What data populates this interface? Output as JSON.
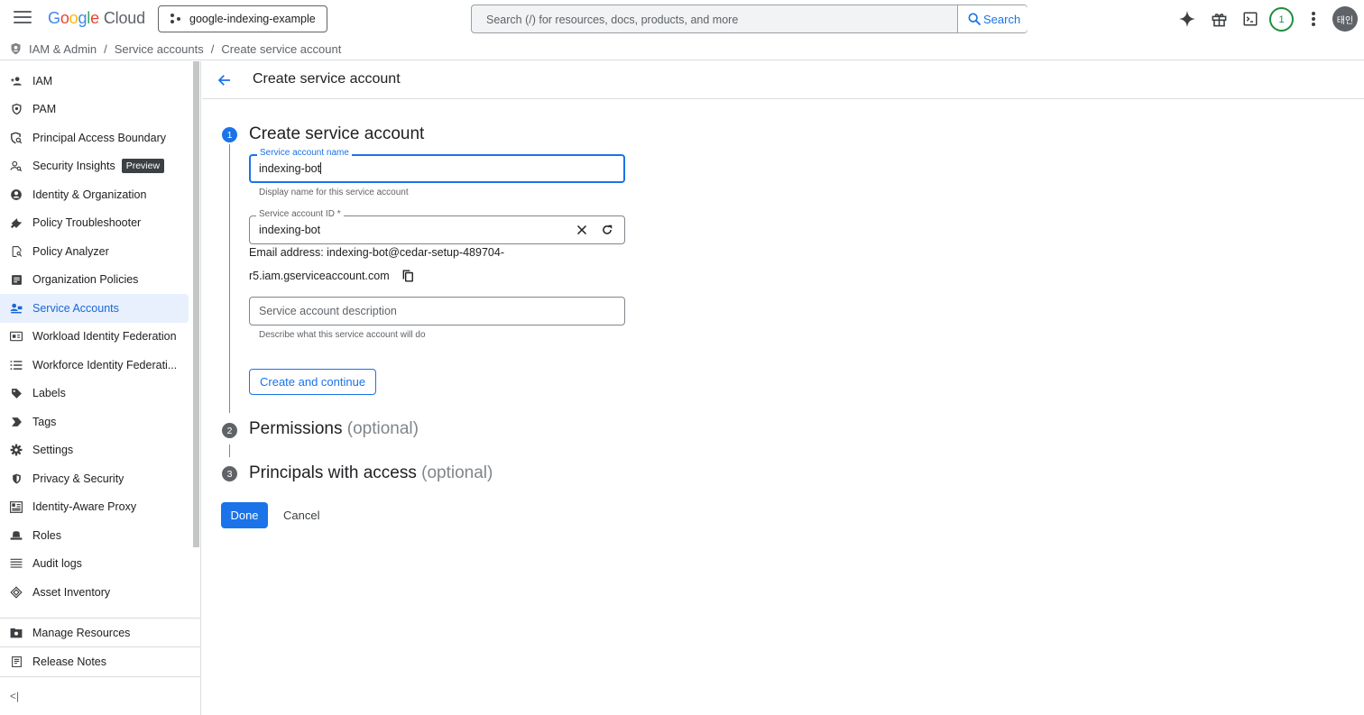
{
  "topbar": {
    "logo_letters": [
      "G",
      "o",
      "o",
      "g",
      "l",
      "e"
    ],
    "logo_product": "Cloud",
    "project_name": "google-indexing-example",
    "search_placeholder": "Search (/) for resources, docs, products, and more",
    "search_button": "Search",
    "notification_count": "1",
    "avatar_text": "태인",
    "icons": [
      "menu-icon",
      "gemini-sparkle-icon",
      "gift-icon",
      "cloud-shell-icon",
      "more-vert-icon"
    ]
  },
  "breadcrumb": {
    "items": [
      "IAM & Admin",
      "Service accounts",
      "Create service account"
    ],
    "separator": "/"
  },
  "sidebar": {
    "items": [
      {
        "label": "IAM",
        "icon": "person-add-icon"
      },
      {
        "label": "PAM",
        "icon": "shield-lock-icon"
      },
      {
        "label": "Principal Access Boundary",
        "icon": "shield-search-icon"
      },
      {
        "label": "Security Insights",
        "icon": "person-search-icon",
        "tag": "Preview"
      },
      {
        "label": "Identity & Organization",
        "icon": "account-circle-icon"
      },
      {
        "label": "Policy Troubleshooter",
        "icon": "wrench-icon"
      },
      {
        "label": "Policy Analyzer",
        "icon": "document-search-icon"
      },
      {
        "label": "Organization Policies",
        "icon": "article-icon"
      },
      {
        "label": "Service Accounts",
        "icon": "service-account-icon",
        "active": true
      },
      {
        "label": "Workload Identity Federation",
        "icon": "badge-icon"
      },
      {
        "label": "Workforce Identity Federati...",
        "icon": "list-icon"
      },
      {
        "label": "Labels",
        "icon": "label-icon"
      },
      {
        "label": "Tags",
        "icon": "tag-arrow-icon"
      },
      {
        "label": "Settings",
        "icon": "gear-icon"
      },
      {
        "label": "Privacy & Security",
        "icon": "shield-icon"
      },
      {
        "label": "Identity-Aware Proxy",
        "icon": "proxy-icon"
      },
      {
        "label": "Roles",
        "icon": "hat-icon"
      },
      {
        "label": "Audit logs",
        "icon": "lines-icon"
      },
      {
        "label": "Asset Inventory",
        "icon": "diamond-layers-icon"
      }
    ],
    "bottom_items": [
      {
        "label": "Manage Resources",
        "icon": "folder-gear-icon"
      },
      {
        "label": "Release Notes",
        "icon": "notes-icon"
      }
    ],
    "collapse_label": "<|"
  },
  "main": {
    "header_title": "Create service account",
    "steps": [
      {
        "number": "1",
        "title": "Create service account",
        "optional": ""
      },
      {
        "number": "2",
        "title": "Permissions",
        "optional": "(optional)"
      },
      {
        "number": "3",
        "title": "Principals with access",
        "optional": "(optional)"
      }
    ],
    "form": {
      "name_label": "Service account name",
      "name_value": "indexing-bot",
      "name_hint": "Display name for this service account",
      "id_label": "Service account ID *",
      "id_value": "indexing-bot",
      "email_line1": "Email address: indexing-bot@cedar-setup-489704-",
      "email_line2": "r5.iam.gserviceaccount.com",
      "description_placeholder": "Service account description",
      "description_hint": "Describe what this service account will do",
      "continue_button": "Create and continue"
    },
    "done_button": "Done",
    "cancel_button": "Cancel"
  },
  "colors": {
    "accent": "#1a73e8",
    "active_bg": "#e8f0fe",
    "active_text": "#1967d2",
    "notification": "#1e8e3e"
  }
}
